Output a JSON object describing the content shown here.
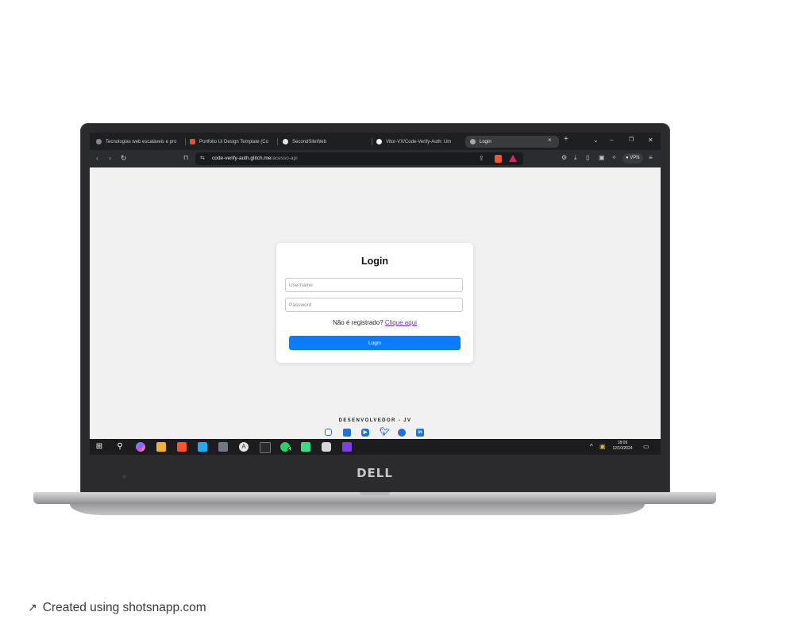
{
  "browser": {
    "tabs": [
      {
        "title": "Tecnologias web escaláveis e pro",
        "icon": "globe-icon"
      },
      {
        "title": "Portfolio Ui Design Template (Co",
        "icon": "figma-icon"
      },
      {
        "title": "SecondSiteWeb",
        "icon": "shield-check-icon"
      },
      {
        "title": "Vitor-VX/Code-Verify-Auth: Um ",
        "icon": "github-icon"
      },
      {
        "title": "Login",
        "icon": "globe-icon",
        "active": true
      }
    ],
    "new_tab_icon": "+",
    "url_host": "code-verify-auth.glitch.me",
    "url_path": "/acesso-api",
    "vpn_label": "VPN"
  },
  "page": {
    "title": "Login",
    "username_placeholder": "Username",
    "password_placeholder": "Password",
    "register_text": "Não é registrado?",
    "register_link": "Clique aqui",
    "login_button": "Login",
    "footer_credit": "DESENVOLVEDOR - JV",
    "social_icons": [
      "instagram-icon",
      "twitch-icon",
      "youtube-icon",
      "twitter-icon",
      "github-icon",
      "linkedin-icon"
    ]
  },
  "taskbar": {
    "time": "18:09",
    "date": "12/10/2024",
    "whatsapp_badge": "4"
  },
  "device": {
    "brand": "DELL"
  },
  "watermark": {
    "text": "Created using shotsnapp.com"
  },
  "colors": {
    "accent": "#0d7bff",
    "link": "#6a35b8",
    "page_bg": "#f1f1f1",
    "browser_dark": "#1e1f22"
  }
}
